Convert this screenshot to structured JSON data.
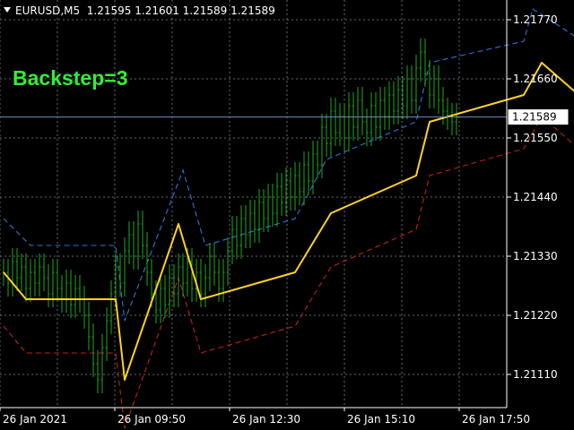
{
  "header": {
    "symbol": "EURUSD,M5",
    "ohlc": "1.21595 1.21601 1.21589 1.21589"
  },
  "overlay_label": "Backstep=3",
  "colors": {
    "background": "#000000",
    "grid": "#8a9aa8",
    "candles": "#1eaa1e",
    "zigzag": "#ffd21e",
    "upper_band": "#2f74d8",
    "lower_band": "#c0201e",
    "price_line": "#6f8fb6",
    "axis_text": "#ffffff"
  },
  "chart_data": {
    "type": "line",
    "symbol": "EURUSD",
    "timeframe": "M5",
    "y_ticks": [
      "1.21770",
      "1.21660",
      "1.21550",
      "1.21440",
      "1.21330",
      "1.21220",
      "1.21110"
    ],
    "ylim": [
      1.2105,
      1.218
    ],
    "x_ticks": [
      "26 Jan 2021",
      "26 Jan 09:50",
      "26 Jan 12:30",
      "26 Jan 15:10",
      "26 Jan 17:50"
    ],
    "current_price": "1.21589",
    "series": [
      {
        "name": "ZigZag",
        "x": [
          "26 Jan 07:20",
          "26 Jan 07:45",
          "26 Jan 09:25",
          "26 Jan 09:35",
          "26 Jan 10:35",
          "26 Jan 11:00",
          "26 Jan 12:45",
          "26 Jan 13:25",
          "26 Jan 15:00",
          "26 Jan 15:15",
          "26 Jan 17:00",
          "26 Jan 17:20",
          "26 Jan 18:15"
        ],
        "values": [
          1.213,
          1.2125,
          1.2125,
          1.211,
          1.2139,
          1.2125,
          1.213,
          1.2141,
          1.2148,
          1.2158,
          1.2163,
          1.2169,
          1.2161
        ]
      },
      {
        "name": "Upper band",
        "x": [
          "26 Jan 07:20",
          "26 Jan 07:50",
          "26 Jan 09:25",
          "26 Jan 09:35",
          "26 Jan 10:40",
          "26 Jan 11:05",
          "26 Jan 12:45",
          "26 Jan 13:20",
          "26 Jan 15:00",
          "26 Jan 15:15",
          "26 Jan 17:00",
          "26 Jan 17:10",
          "26 Jan 18:15"
        ],
        "values": [
          1.214,
          1.2135,
          1.2135,
          1.2121,
          1.2149,
          1.2135,
          1.214,
          1.2151,
          1.2158,
          1.2169,
          1.2173,
          1.2179,
          1.2172
        ]
      },
      {
        "name": "Lower band",
        "x": [
          "26 Jan 07:20",
          "26 Jan 07:45",
          "26 Jan 09:25",
          "26 Jan 09:35",
          "26 Jan 10:35",
          "26 Jan 11:00",
          "26 Jan 12:45",
          "26 Jan 13:25",
          "26 Jan 15:00",
          "26 Jan 15:15",
          "26 Jan 17:00",
          "26 Jan 17:20",
          "26 Jan 18:15"
        ],
        "values": [
          1.212,
          1.2115,
          1.2115,
          1.2101,
          1.2129,
          1.2115,
          1.212,
          1.2131,
          1.2138,
          1.2148,
          1.2153,
          1.2159,
          1.2151
        ]
      }
    ],
    "candles": {
      "x_start": "26 Jan 07:20",
      "interval_minutes": 5,
      "close": [
        1.213,
        1.2128,
        1.2132,
        1.2129,
        1.2131,
        1.2127,
        1.213,
        1.2128,
        1.2131,
        1.2129,
        1.2126,
        1.213,
        1.2127,
        1.2125,
        1.2128,
        1.2124,
        1.2127,
        1.2125,
        1.2122,
        1.2118,
        1.2113,
        1.211,
        1.2116,
        1.2121,
        1.2126,
        1.2131,
        1.2128,
        1.2134,
        1.2137,
        1.2133,
        1.2139,
        1.2135,
        1.213,
        1.2126,
        1.2123,
        1.2127,
        1.2124,
        1.2129,
        1.2126,
        1.2131,
        1.2128,
        1.2132,
        1.2127,
        1.213,
        1.2126,
        1.2129,
        1.2133,
        1.213,
        1.2127,
        1.213,
        1.2134,
        1.2138,
        1.2135,
        1.214,
        1.2137,
        1.2141,
        1.2138,
        1.2143,
        1.214,
        1.2144,
        1.2141,
        1.2146,
        1.2143,
        1.2147,
        1.2144,
        1.2148,
        1.2145,
        1.215,
        1.2147,
        1.2152,
        1.215,
        1.2157,
        1.2154,
        1.216,
        1.2156,
        1.2159,
        1.2155,
        1.2161,
        1.2157,
        1.2162,
        1.2158,
        1.2156,
        1.2161,
        1.2157,
        1.2162,
        1.2159,
        1.2163,
        1.216,
        1.2164,
        1.2161,
        1.2166,
        1.2162,
        1.2168,
        1.2171,
        1.2167,
        1.2163,
        1.2166,
        1.2162,
        1.216,
        1.2159,
        1.2158,
        1.2159
      ]
    }
  }
}
